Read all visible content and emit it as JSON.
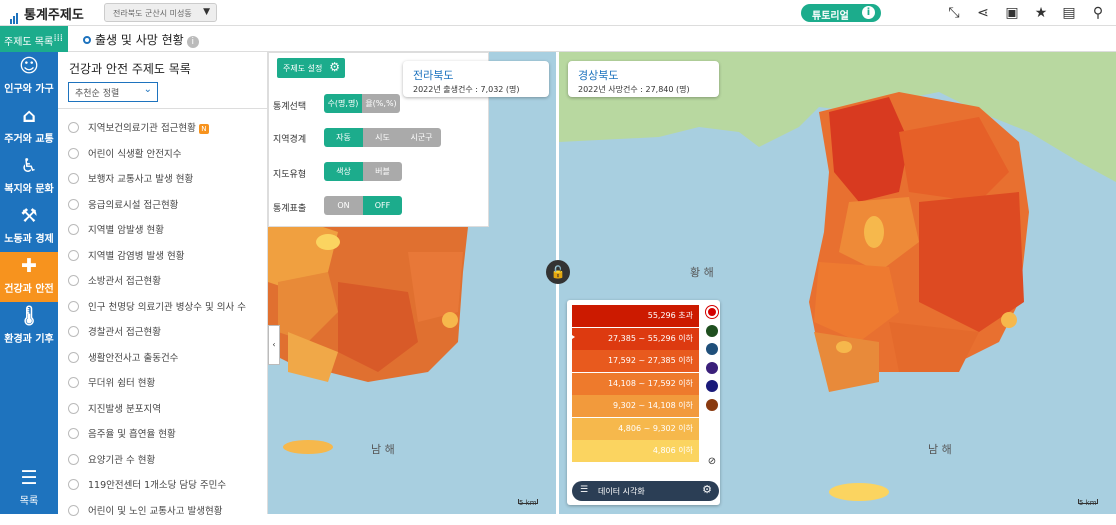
{
  "header": {
    "app_title": "통계주제도",
    "region_select": "전라북도 군산시 미성동",
    "tutorial_label": "튜토리얼"
  },
  "subbar": {
    "theme_list_label": "주제도 목록",
    "page_title": "출생 및 사망 현황"
  },
  "nav": {
    "items": [
      {
        "label": "인구와 가구",
        "icon": "people-icon"
      },
      {
        "label": "주거와 교통",
        "icon": "house-car-icon"
      },
      {
        "label": "복지와 문화",
        "icon": "welfare-icon"
      },
      {
        "label": "노동과 경제",
        "icon": "worker-icon"
      },
      {
        "label": "건강과 안전",
        "icon": "health-icon"
      },
      {
        "label": "환경과 기후",
        "icon": "thermometer-icon"
      }
    ],
    "menu_label": "목록"
  },
  "list_panel": {
    "title": "건강과 안전 주제도 목록",
    "sort_label": "추천순 정렬",
    "items": [
      "지역보건의료기관 접근현황",
      "어린이 식생활 안전지수",
      "보행자 교통사고 발생 현황",
      "응급의료시설 접근현황",
      "지역별 암발생 현황",
      "지역별 감염병 발생 현황",
      "소방관서 접근현황",
      "인구 천명당 의료기관 병상수 및 의사 수",
      "경찰관서 접근현황",
      "생활안전사고 출동건수",
      "무더위 쉼터 현황",
      "지진발생 분포지역",
      "음주율 및 흡연율 현황",
      "요양기관 수 현황",
      "119안전센터 1개소당 담당 주민수",
      "어린이 및 노인 교통사고 발생현황"
    ],
    "new_badge": "N"
  },
  "settings": {
    "button_label": "주제도 설정",
    "stat_select_label": "통계선택",
    "stat_options": [
      "수(명,명)",
      "율(%,%)"
    ],
    "region_boundary_label": "지역경계",
    "region_options": [
      "자동",
      "시도",
      "시군구"
    ],
    "map_type_label": "지도유형",
    "map_type_options": [
      "색상",
      "버블"
    ],
    "stat_display_label": "통계표출",
    "stat_display_options": [
      "ON",
      "OFF"
    ]
  },
  "left_tooltip": {
    "region": "전라북도",
    "value_text": "2022년 출생건수  :  7,032 (명)"
  },
  "right_tooltip": {
    "region": "경상북도",
    "value_text": "2022년 사망건수  :  27,840 (명)"
  },
  "legend": {
    "rows": [
      {
        "label": "55,296 초과",
        "color": "#cc1a00"
      },
      {
        "label": "27,385 ~ 55,296 이하",
        "color": "#dd3a10"
      },
      {
        "label": "17,592 ~ 27,385 이하",
        "color": "#e85a1e"
      },
      {
        "label": "14,108 ~ 17,592 이하",
        "color": "#ee7a2c"
      },
      {
        "label": "9,302 ~ 14,108 이하",
        "color": "#f29a3c"
      },
      {
        "label": "4,806 ~ 9,302 이하",
        "color": "#f6b84c"
      },
      {
        "label": "4,806 이하",
        "color": "#fbd460"
      }
    ],
    "color_options": [
      "#d40000",
      "#1f4f1f",
      "#1f4f7a",
      "#3a1f7a",
      "#1a1a7a",
      "#8a3a10"
    ],
    "viz_label": "데이터 시각화"
  },
  "map_labels": {
    "east_sea": "황 해",
    "south_sea_left": "남 해",
    "south_sea_right": "남 해",
    "scale": "5 km"
  }
}
